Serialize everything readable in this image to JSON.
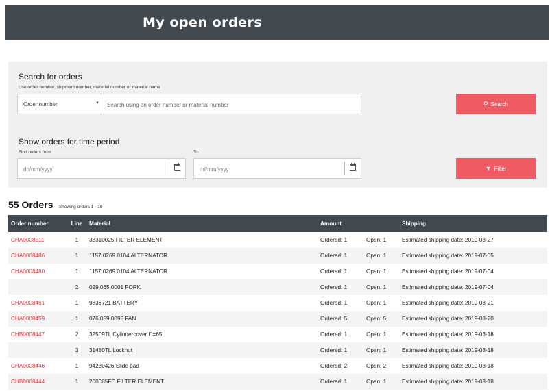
{
  "header": {
    "title": "My open orders"
  },
  "search": {
    "title": "Search for orders",
    "hint": "Use order number, shipment number, material number or material name",
    "select_value": "Order number",
    "placeholder": "Search using an order number or material number",
    "button_label": "Search",
    "button_icon": "search-icon"
  },
  "period": {
    "title": "Show orders for time period",
    "from_label": "Find orders from",
    "to_label": "To",
    "from_placeholder": "dd/mm/yyyy",
    "to_placeholder": "dd/mm/yyyy",
    "button_label": "Filter",
    "button_icon": "filter-icon"
  },
  "orders": {
    "count_label": "55 Orders",
    "showing_label": "Showing orders 1 - 10",
    "columns": [
      "Order number",
      "Line",
      "Material",
      "Amount",
      "Shipping"
    ],
    "rows": [
      {
        "order": "CHA0008511",
        "line": "1",
        "material": "38310025 FILTER ELEMENT",
        "ordered": "Ordered: 1",
        "open": "Open: 1",
        "shipping": "Estimated shipping date: 2019-03-27"
      },
      {
        "order": "CHA0008486",
        "line": "1",
        "material": "1157.0269.0104 ALTERNATOR",
        "ordered": "Ordered: 1",
        "open": "Open: 1",
        "shipping": "Estimated shipping date: 2019-07-05"
      },
      {
        "order": "CHA0008480",
        "line": "1",
        "material": "1157.0269.0104 ALTERNATOR",
        "ordered": "Ordered: 1",
        "open": "Open: 1",
        "shipping": "Estimated shipping date: 2019-07-04"
      },
      {
        "order": "",
        "line": "2",
        "material": "029.065.0001 FORK",
        "ordered": "Ordered: 1",
        "open": "Open: 1",
        "shipping": "Estimated shipping date: 2019-07-04"
      },
      {
        "order": "CHA0008461",
        "line": "1",
        "material": "9836721 BATTERY",
        "ordered": "Ordered: 1",
        "open": "Open: 1",
        "shipping": "Estimated shipping date: 2019-03-21"
      },
      {
        "order": "CHA0008459",
        "line": "1",
        "material": "076.059.0095 FAN",
        "ordered": "Ordered: 5",
        "open": "Open: 5",
        "shipping": "Estimated shipping date: 2019-03-20"
      },
      {
        "order": "CHB0008447",
        "line": "2",
        "material": "32509TL Cylindercover D=65",
        "ordered": "Ordered: 1",
        "open": "Open: 1",
        "shipping": "Estimated shipping date: 2019-03-18"
      },
      {
        "order": "",
        "line": "3",
        "material": "31480TL Locknut",
        "ordered": "Ordered: 1",
        "open": "Open: 1",
        "shipping": "Estimated shipping date: 2019-03-18"
      },
      {
        "order": "CHA0008446",
        "line": "1",
        "material": "94230426 Slide pad",
        "ordered": "Ordered: 2",
        "open": "Open: 2",
        "shipping": "Estimated shipping date: 2019-03-18"
      },
      {
        "order": "CHB0008444",
        "line": "1",
        "material": "200085FC FILTER ELEMENT",
        "ordered": "Ordered: 1",
        "open": "Open: 1",
        "shipping": "Estimated shipping date: 2019-03-18"
      }
    ]
  },
  "colors": {
    "header_bg": "#424a4f",
    "accent": "#f05a62",
    "link": "#e8353d",
    "panel_bg": "#f0f0f0"
  }
}
